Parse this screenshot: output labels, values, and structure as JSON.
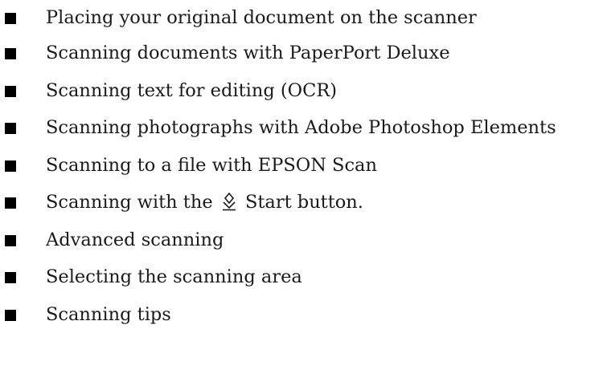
{
  "list": {
    "items": [
      {
        "text": "Placing your original document on the scanner"
      },
      {
        "text": "Scanning documents with PaperPort Deluxe"
      },
      {
        "text": "Scanning text for editing (OCR)"
      },
      {
        "text": "Scanning photographs with Adobe Photoshop Elements"
      },
      {
        "text": "Scanning to a file with EPSON Scan"
      },
      {
        "text_before": "Scanning with the",
        "icon": "start-button-icon",
        "text_after": "Start button."
      },
      {
        "text": "Advanced scanning"
      },
      {
        "text": "Selecting the scanning area"
      },
      {
        "text": "Scanning tips"
      }
    ]
  },
  "colors": {
    "text": "#1a1a1a",
    "bullet": "#000000"
  }
}
